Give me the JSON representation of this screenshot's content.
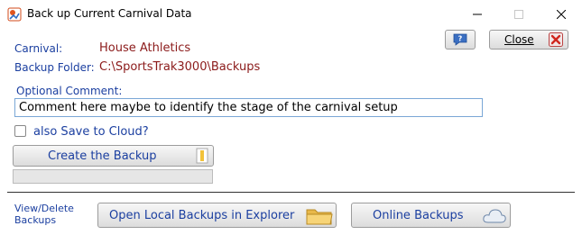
{
  "window": {
    "title": "Back up Current Carnival Data"
  },
  "carnival": {
    "label": "Carnival:",
    "value": "House Athletics"
  },
  "backup_folder": {
    "label": "Backup Folder:",
    "value": "C:\\SportsTrak3000\\Backups"
  },
  "comment": {
    "label": "Optional Comment:",
    "value": "Comment here maybe to identify the stage of the carnival setup"
  },
  "cloud": {
    "label": "also Save to Cloud?",
    "checked": false
  },
  "buttons": {
    "close": "Close",
    "create": "Create the Backup",
    "open_local": "Open Local Backups in Explorer",
    "online": "Online Backups"
  },
  "view_delete": {
    "line1": "View/Delete",
    "line2": "Backups"
  },
  "progress": {
    "value": 0
  }
}
